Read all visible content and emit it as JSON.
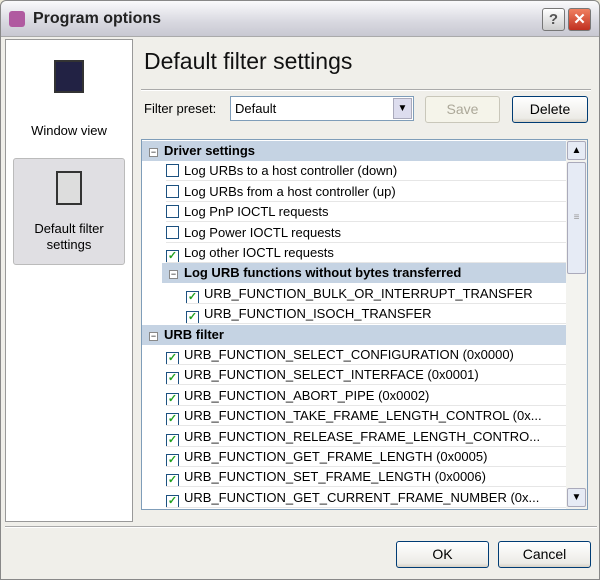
{
  "window": {
    "title": "Program options",
    "help": "?",
    "close": "✕"
  },
  "sidebar": {
    "items": [
      {
        "label": "Window view"
      },
      {
        "label": "Default filter settings"
      }
    ]
  },
  "main": {
    "title": "Default filter settings",
    "preset_label": "Filter preset:",
    "preset_value": "Default",
    "save": "Save",
    "delete": "Delete"
  },
  "list": {
    "rows": [
      {
        "type": "group",
        "level": 0,
        "label": "Driver settings"
      },
      {
        "type": "item",
        "level": 1,
        "checked": false,
        "label": "Log URBs to a host controller (down)"
      },
      {
        "type": "item",
        "level": 1,
        "checked": false,
        "label": "Log URBs from a host controller (up)"
      },
      {
        "type": "item",
        "level": 1,
        "checked": false,
        "label": "Log PnP IOCTL requests"
      },
      {
        "type": "item",
        "level": 1,
        "checked": false,
        "label": "Log Power IOCTL requests"
      },
      {
        "type": "item",
        "level": 1,
        "checked": true,
        "label": "Log other IOCTL requests"
      },
      {
        "type": "group",
        "level": 1,
        "label": "Log URB functions without bytes transferred"
      },
      {
        "type": "item",
        "level": 2,
        "checked": true,
        "label": "URB_FUNCTION_BULK_OR_INTERRUPT_TRANSFER"
      },
      {
        "type": "item",
        "level": 2,
        "checked": true,
        "label": "URB_FUNCTION_ISOCH_TRANSFER"
      },
      {
        "type": "group",
        "level": 0,
        "label": "URB filter"
      },
      {
        "type": "item",
        "level": 1,
        "checked": true,
        "label": "URB_FUNCTION_SELECT_CONFIGURATION (0x0000)"
      },
      {
        "type": "item",
        "level": 1,
        "checked": true,
        "label": "URB_FUNCTION_SELECT_INTERFACE (0x0001)"
      },
      {
        "type": "item",
        "level": 1,
        "checked": true,
        "label": "URB_FUNCTION_ABORT_PIPE (0x0002)"
      },
      {
        "type": "item",
        "level": 1,
        "checked": true,
        "label": "URB_FUNCTION_TAKE_FRAME_LENGTH_CONTROL (0x..."
      },
      {
        "type": "item",
        "level": 1,
        "checked": true,
        "label": "URB_FUNCTION_RELEASE_FRAME_LENGTH_CONTRO..."
      },
      {
        "type": "item",
        "level": 1,
        "checked": true,
        "label": "URB_FUNCTION_GET_FRAME_LENGTH (0x0005)"
      },
      {
        "type": "item",
        "level": 1,
        "checked": true,
        "label": "URB_FUNCTION_SET_FRAME_LENGTH (0x0006)"
      },
      {
        "type": "item",
        "level": 1,
        "checked": true,
        "label": "URB_FUNCTION_GET_CURRENT_FRAME_NUMBER (0x..."
      }
    ]
  },
  "footer": {
    "ok": "OK",
    "cancel": "Cancel"
  }
}
